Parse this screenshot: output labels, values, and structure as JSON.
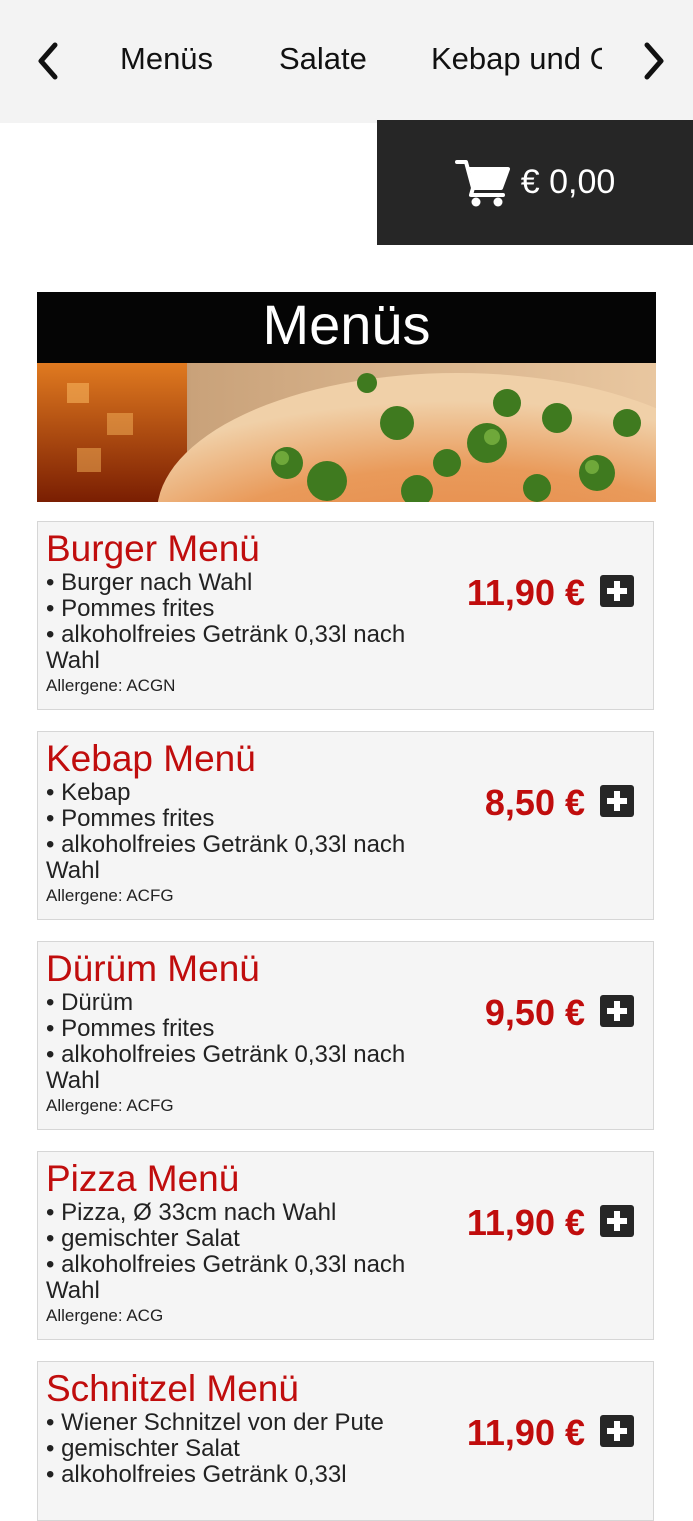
{
  "nav": {
    "tabs": [
      "Menüs",
      "Salate",
      "Kebap und G"
    ],
    "prev_icon": "chevron-left-icon",
    "next_icon": "chevron-right-icon"
  },
  "cart": {
    "icon": "shopping-cart-icon",
    "total": "€ 0,00"
  },
  "section": {
    "title": "Menüs"
  },
  "colors": {
    "accent": "#c00d0d",
    "dark": "#262626",
    "card_bg": "#f5f5f5"
  },
  "items": [
    {
      "name": "Burger Menü",
      "lines": [
        "• Burger nach Wahl",
        "• Pommes frites",
        "• alkoholfreies Getränk 0,33l nach Wahl"
      ],
      "allergens": "Allergene: ACGN",
      "price": "11,90 €"
    },
    {
      "name": "Kebap Menü",
      "lines": [
        "• Kebap",
        "• Pommes frites",
        "• alkoholfreies Getränk 0,33l nach Wahl"
      ],
      "allergens": "Allergene: ACFG",
      "price": "8,50 €"
    },
    {
      "name": "Dürüm Menü",
      "lines": [
        "• Dürüm",
        "• Pommes frites",
        "• alkoholfreies Getränk 0,33l nach Wahl"
      ],
      "allergens": "Allergene: ACFG",
      "price": "9,50 €"
    },
    {
      "name": "Pizza Menü",
      "lines": [
        "• Pizza, Ø 33cm nach Wahl",
        "• gemischter Salat",
        "• alkoholfreies Getränk 0,33l nach Wahl"
      ],
      "allergens": "Allergene: ACG",
      "price": "11,90 €"
    },
    {
      "name": "Schnitzel Menü",
      "lines": [
        "• Wiener Schnitzel von der Pute",
        "• gemischter Salat",
        "• alkoholfreies Getränk 0,33l"
      ],
      "allergens": "",
      "price": "11,90 €"
    }
  ]
}
